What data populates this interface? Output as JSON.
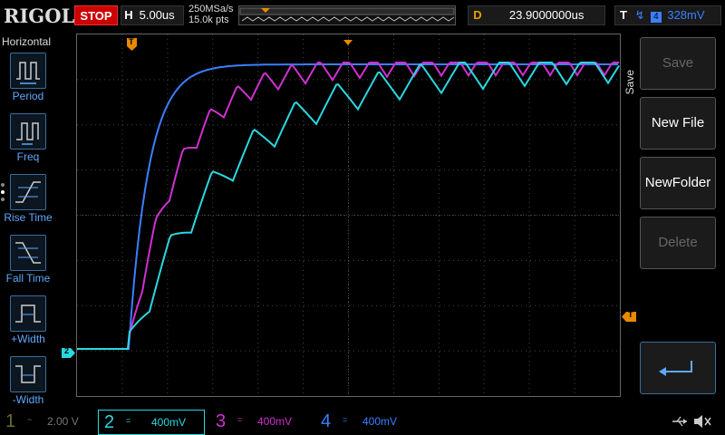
{
  "top": {
    "brand": "RIGOL",
    "status": "STOP",
    "horizontal": {
      "key": "H",
      "value": "5.00us"
    },
    "sample_rate": "250MSa/s",
    "points": "15.0k pts",
    "delay": {
      "key": "D",
      "value": "23.9000000us"
    },
    "trigger": {
      "key": "T",
      "source": "4",
      "level": "328mV"
    }
  },
  "left_menu": {
    "title": "Horizontal",
    "items": [
      {
        "label": "Period",
        "icon": "period-icon"
      },
      {
        "label": "Freq",
        "icon": "freq-icon"
      },
      {
        "label": "Rise Time",
        "icon": "rise-time-icon"
      },
      {
        "label": "Fall Time",
        "icon": "fall-time-icon"
      },
      {
        "label": "+Width",
        "icon": "pos-width-icon"
      },
      {
        "label": "-Width",
        "icon": "neg-width-icon"
      }
    ]
  },
  "right_menu": {
    "title": "Save",
    "items": [
      {
        "label": "Save",
        "enabled": false
      },
      {
        "label": "New File",
        "enabled": true
      },
      {
        "label": "NewFolder",
        "enabled": true
      },
      {
        "label": "Delete",
        "enabled": false
      }
    ],
    "enter_icon": "enter-icon"
  },
  "markers": {
    "trigger_pos": "T",
    "trigger_level": "T",
    "channel_ref": "2"
  },
  "channels": [
    {
      "num": "1",
      "coupling": "~",
      "scale": "2.00 V",
      "color": "#6a6a2a"
    },
    {
      "num": "2",
      "coupling": "=",
      "scale": "400mV",
      "color": "#2de0e8"
    },
    {
      "num": "3",
      "coupling": "=",
      "scale": "400mV",
      "color": "#d040d0"
    },
    {
      "num": "4",
      "coupling": "=",
      "scale": "400mV",
      "color": "#3a7fff"
    }
  ],
  "colors": {
    "ch2": "#2ad8e0",
    "ch3": "#d030d0",
    "ch4": "#3b7fff",
    "trigger": "#e88a00",
    "menu_accent": "#5fa8ff"
  }
}
